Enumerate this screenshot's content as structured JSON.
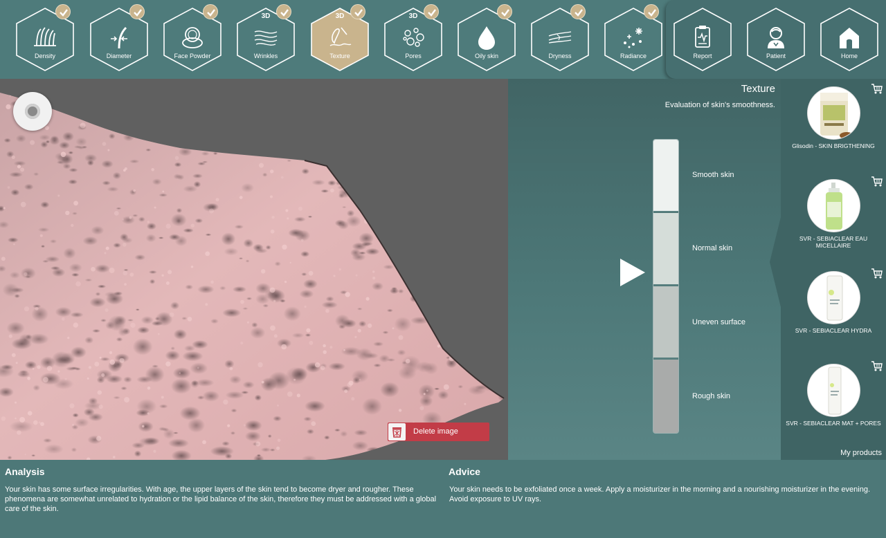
{
  "nav": {
    "items": [
      {
        "label": "Density",
        "icon": "density-icon",
        "done": true,
        "badge": ""
      },
      {
        "label": "Diameter",
        "icon": "diameter-icon",
        "done": true,
        "badge": ""
      },
      {
        "label": "Face Powder",
        "icon": "face-powder-icon",
        "done": true,
        "badge": ""
      },
      {
        "label": "Wrinkles",
        "icon": "wrinkles-icon",
        "done": true,
        "badge": "3D"
      },
      {
        "label": "Texture",
        "icon": "texture-icon",
        "done": true,
        "badge": "3D",
        "active": true
      },
      {
        "label": "Pores",
        "icon": "pores-icon",
        "done": true,
        "badge": "3D"
      },
      {
        "label": "Oily skin",
        "icon": "oily-skin-icon",
        "done": true,
        "badge": ""
      },
      {
        "label": "Dryness",
        "icon": "dryness-icon",
        "done": true,
        "badge": ""
      },
      {
        "label": "Radiance",
        "icon": "radiance-icon",
        "done": true,
        "badge": ""
      }
    ],
    "right_items": [
      {
        "label": "Report",
        "icon": "report-icon"
      },
      {
        "label": "Patient",
        "icon": "patient-icon"
      },
      {
        "label": "Home",
        "icon": "home-icon"
      }
    ]
  },
  "viewer": {
    "delete_label": "Delete image"
  },
  "scale": {
    "title": "Texture",
    "subtitle": "Evaluation of skin's smoothness.",
    "levels": [
      {
        "label": "Smooth skin",
        "color": "#eef2f0"
      },
      {
        "label": "Normal skin",
        "color": "#d5ddd9"
      },
      {
        "label": "Uneven surface",
        "color": "#bfc6c3"
      },
      {
        "label": "Rough skin",
        "color": "#a9abaa"
      }
    ],
    "indicator_level": "Uneven surface"
  },
  "products": {
    "items": [
      {
        "name": "Glisodin  -  SKIN BRIGTHENING"
      },
      {
        "name": "SVR  -  SEBIACLEAR EAU MICELLAIRE"
      },
      {
        "name": "SVR  -  SEBIACLEAR HYDRA"
      },
      {
        "name": "SVR  -  SEBIACLEAR MAT + PORES"
      }
    ],
    "footer_label": "My products"
  },
  "analysis": {
    "title": "Analysis",
    "text": "Your skin has some surface irregularities. With age, the upper layers of the skin tend to become dryer and rougher. These phenomena are somewhat unrelated to hydration or the lipid balance of the skin, therefore they must be addressed with a global care of the skin."
  },
  "advice": {
    "title": "Advice",
    "text": "Your skin needs to be exfoliated once a week. Apply a moisturizer in the morning and a nourishing moisturizer in the evening. Avoid exposure to UV rays."
  },
  "colors": {
    "accent": "#c9b48d",
    "background": "#4d7878",
    "delete": "#c23c47"
  }
}
